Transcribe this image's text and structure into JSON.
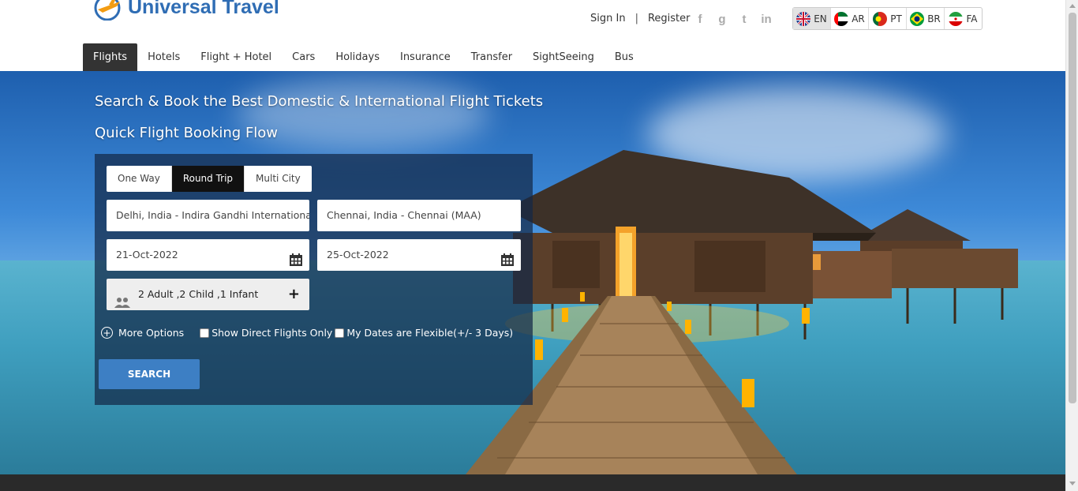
{
  "brand": {
    "name": "Universal Travel"
  },
  "auth": {
    "sign_in": "Sign In",
    "separator": "|",
    "register": "Register"
  },
  "social": [
    "facebook-icon",
    "google-icon",
    "twitter-icon",
    "linkedin-icon"
  ],
  "social_glyphs": {
    "facebook": "f",
    "google": "g",
    "twitter": "t",
    "linkedin": "in"
  },
  "languages": [
    {
      "code": "EN",
      "flag": "uk-flag-icon",
      "active": true
    },
    {
      "code": "AR",
      "flag": "uae-flag-icon"
    },
    {
      "code": "PT",
      "flag": "portugal-flag-icon"
    },
    {
      "code": "BR",
      "flag": "brazil-flag-icon"
    },
    {
      "code": "FA",
      "flag": "iran-flag-icon"
    }
  ],
  "nav": {
    "items": [
      "Flights",
      "Hotels",
      "Flight + Hotel",
      "Cars",
      "Holidays",
      "Insurance",
      "Transfer",
      "SightSeeing",
      "Bus"
    ],
    "active": "Flights"
  },
  "hero": {
    "title": "Search & Book the Best Domestic & International Flight Tickets",
    "subtitle": "Quick Flight Booking Flow"
  },
  "booking": {
    "trip_types": [
      "One Way",
      "Round Trip",
      "Multi City"
    ],
    "active_trip": "Round Trip",
    "from": "Delhi, India - Indira Gandhi International Airport (DEL)",
    "to": "Chennai, India - Chennai (MAA)",
    "depart_date": "21-Oct-2022",
    "return_date": "25-Oct-2022",
    "passengers": "2 Adult ,2 Child ,1 Infant",
    "more_options": "More Options",
    "direct_flights": "Show Direct Flights Only",
    "flexible_dates": "My Dates are Flexible(+/- 3 Days)",
    "search_button": "SEARCH"
  },
  "colors": {
    "brand": "#2f6db4",
    "search_button": "#3d7fc4",
    "nav_active": "#333333"
  }
}
